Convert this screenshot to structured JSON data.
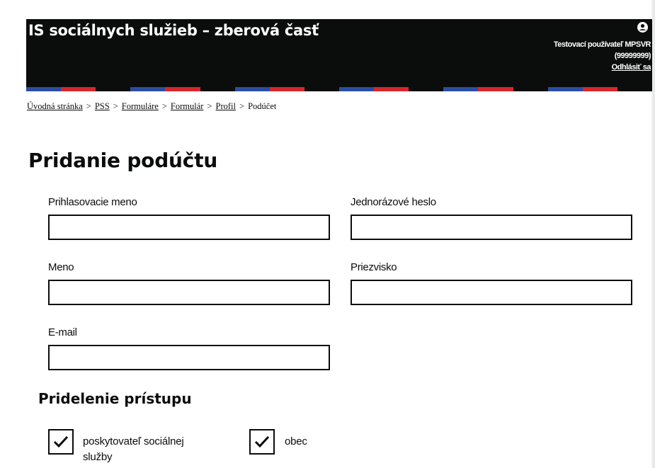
{
  "colors": {
    "header_bg": "#0b0c0c",
    "header_text": "#ffffff",
    "flag_blue": "#2b4ea2",
    "flag_red": "#d9262e",
    "text": "#0b0c0c"
  },
  "header": {
    "title": "IS sociálnych služieb – zberová časť",
    "user_icon": "user-circle-icon",
    "user_name": "Testovací používateľ MPSVR",
    "user_id": "(99999999)",
    "logout_label": "Odhlásiť sa"
  },
  "breadcrumb": {
    "items": [
      "Úvodná stránka",
      "PSS",
      "Formuláre",
      "Formulár",
      "Profil"
    ],
    "separator": ">",
    "current": "Podúčet"
  },
  "page": {
    "title": "Pridanie podúčtu"
  },
  "form": {
    "login_label": "Prihlasovacie meno",
    "login_value": "",
    "password_label": "Jednorázové heslo",
    "password_value": "",
    "first_name_label": "Meno",
    "first_name_value": "",
    "last_name_label": "Priezvisko",
    "last_name_value": "",
    "email_label": "E-mail",
    "email_value": ""
  },
  "access": {
    "title": "Pridelenie prístupu",
    "options": [
      {
        "label": "poskytovateľ sociálnej služby",
        "checked": true
      },
      {
        "label": "obec",
        "checked": true
      }
    ]
  }
}
